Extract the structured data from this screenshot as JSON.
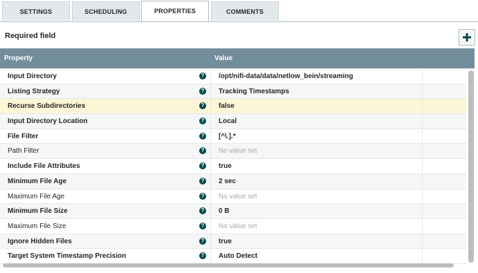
{
  "tabs": [
    "SETTINGS",
    "SCHEDULING",
    "PROPERTIES",
    "COMMENTS"
  ],
  "active_tab": "PROPERTIES",
  "required_label": "Required field",
  "add_button_icon": "plus-icon",
  "table": {
    "columns": [
      "Property",
      "Value"
    ],
    "rows": [
      {
        "name": "Input Directory",
        "value": "/opt/nifi-data/data/netlow_bein/streaming",
        "required": true,
        "unset": false
      },
      {
        "name": "Listing Strategy",
        "value": "Tracking Timestamps",
        "required": true,
        "unset": false
      },
      {
        "name": "Recurse Subdirectories",
        "value": "false",
        "required": true,
        "unset": false,
        "highlighted": true
      },
      {
        "name": "Input Directory Location",
        "value": "Local",
        "required": true,
        "unset": false
      },
      {
        "name": "File Filter",
        "value": "[^\\.].*",
        "required": true,
        "unset": false
      },
      {
        "name": "Path Filter",
        "value": "No value set",
        "required": false,
        "unset": true
      },
      {
        "name": "Include File Attributes",
        "value": "true",
        "required": true,
        "unset": false
      },
      {
        "name": "Minimum File Age",
        "value": "2 sec",
        "required": true,
        "unset": false
      },
      {
        "name": "Maximum File Age",
        "value": "No value set",
        "required": false,
        "unset": true
      },
      {
        "name": "Minimum File Size",
        "value": "0 B",
        "required": true,
        "unset": false
      },
      {
        "name": "Maximum File Size",
        "value": "No value set",
        "required": false,
        "unset": true
      },
      {
        "name": "Ignore Hidden Files",
        "value": "true",
        "required": true,
        "unset": false
      },
      {
        "name": "Target System Timestamp Precision",
        "value": "Auto Detect",
        "required": true,
        "unset": false
      }
    ]
  },
  "colors": {
    "header_bg": "#728e9b",
    "highlight_row": "#fcf6d6",
    "info_icon": "#004849"
  }
}
